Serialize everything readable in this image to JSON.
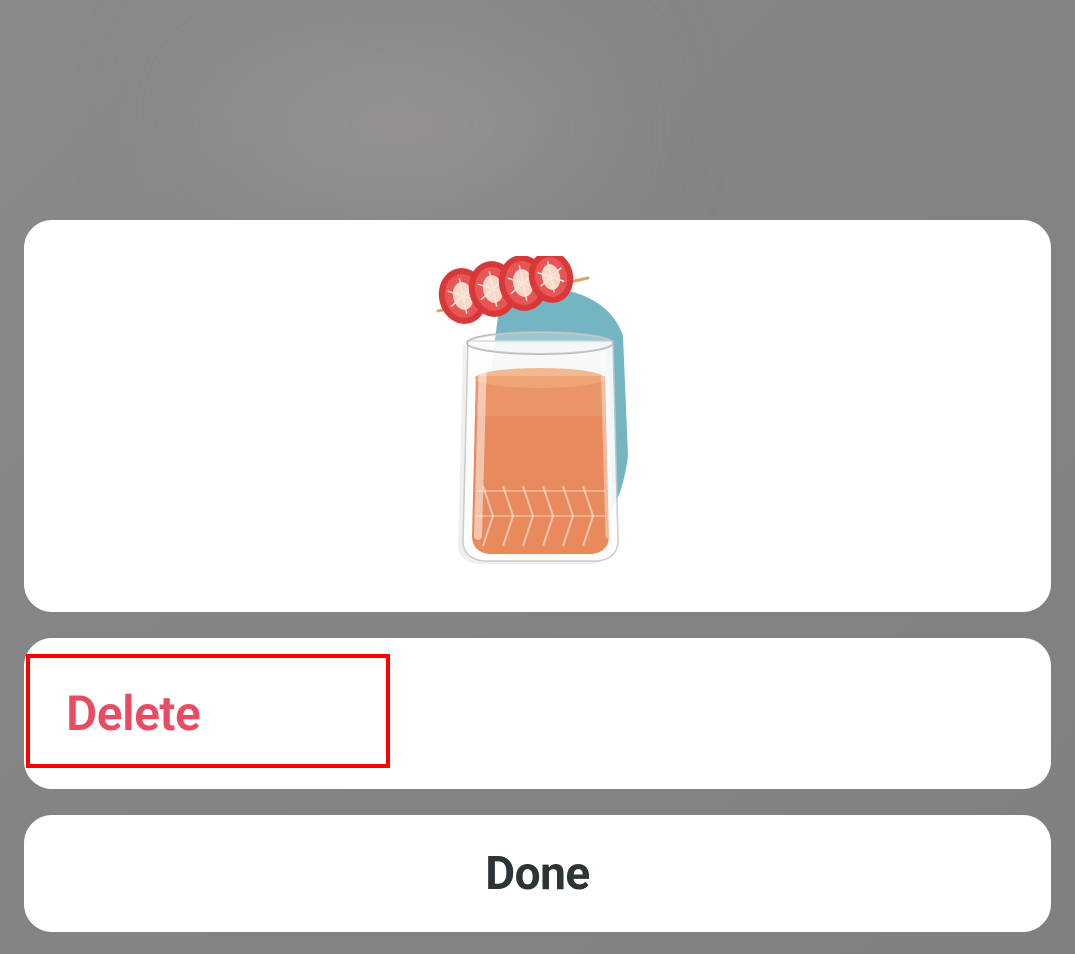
{
  "actionSheet": {
    "imageAlt": "cocktail-drink",
    "deleteLabel": "Delete",
    "doneLabel": "Done",
    "colors": {
      "deleteText": "#e94b63",
      "doneText": "#2d3436",
      "highlightBorder": "#ff0000",
      "cardBackground": "#ffffff",
      "backdrop": "#888888"
    }
  }
}
